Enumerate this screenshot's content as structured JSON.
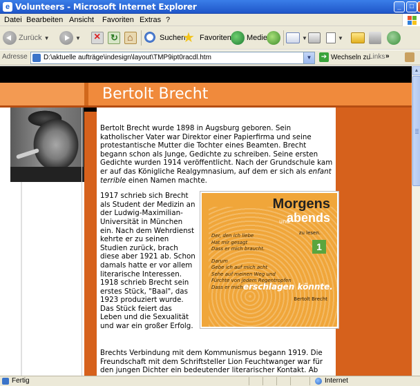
{
  "window": {
    "title": "Volunteers - Microsoft Internet Explorer"
  },
  "menu": [
    "Datei",
    "Bearbeiten",
    "Ansicht",
    "Favoriten",
    "Extras",
    "?"
  ],
  "toolbar": {
    "back": "Zurück",
    "search": "Suchen",
    "favorites": "Favoriten",
    "media": "Medien"
  },
  "address": {
    "label": "Adresse",
    "url": "D:\\aktuelle aufträge\\indesign\\layout\\TMP9ipt0racdl.htm",
    "go": "Wechseln zu",
    "links": "Links",
    "more": "»"
  },
  "page": {
    "heading": "Bertolt Brecht",
    "para1": "Bertolt Brecht wurde 1898 in Augsburg geboren. Sein katholischer Vater war Direktor einer Papierfirma und seine protestantische Mutter die Tochter eines Beamten. Brecht begann schon als Junge, Gedichte zu schreiben. Seine ersten Gedichte wurden 1914 veröffentlicht. Nach der Grundschule kam er auf das Königliche Realgymnasium, auf dem er sich als",
    "para1_em": "enfant terrible",
    "para1_end": "einen Namen machte.",
    "para2": "1917 schrieb sich Brecht als Student der Medizin an der Ludwig-Maximilian-Universität in München ein. Nach dem Wehrdienst kehrte er zu seinen Studien zurück, brach diese aber 1921 ab. Schon damals hatte er vor allem literarische Interessen. 1918 schrieb Brecht sein erstes Stück, \"Baal\", das 1923 produziert wurde. Das Stück feiert das Leben und die Sexualität und war ein großer Erfolg.",
    "para3": "Brechts Verbindung mit dem Kommunismus begann 1919. Die Freundschaft mit dem Schriftsteller Lion Feuchtwanger war für den jungen Dichter ein bedeutender literarischer Kontakt. Ab"
  },
  "poster": {
    "title1": "Morgens",
    "und": "und",
    "title2": "abends",
    "sub": "zu lesen.",
    "number": "1",
    "verse1": [
      "Der, den ich liebe",
      "Hat mir gesagt",
      "Dass er mich braucht."
    ],
    "verse2": [
      "Darum",
      "Gebe ich auf mich acht",
      "Sehe auf meinen Weg und",
      "Fürchte von jedem Regentropfen",
      "Dass er mich"
    ],
    "big": "erschlagen könnte.",
    "author": "Bertolt Brecht"
  },
  "status": {
    "text": "Fertig",
    "zone": "Internet"
  },
  "colors": {
    "orange": "#f08a3c",
    "dark_orange": "#d6611c",
    "titlebar": "#1f56c9"
  }
}
